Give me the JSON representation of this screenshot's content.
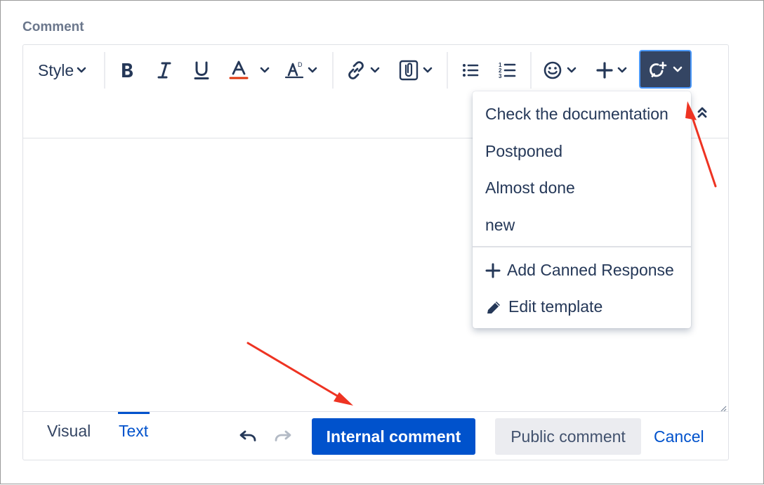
{
  "section_label": "Comment",
  "toolbar": {
    "style_label": "Style",
    "icons": [
      "bold-icon",
      "italic-icon",
      "underline-icon",
      "text-color-icon",
      "text-formatting-icon",
      "link-icon",
      "attachment-icon",
      "bullet-list-icon",
      "numbered-list-icon",
      "emoji-icon",
      "insert-plus-icon",
      "canned-responses-icon"
    ]
  },
  "dropdown": {
    "responses": [
      "Check the documentation",
      "Postponed",
      "Almost done",
      "new"
    ],
    "add_label": "Add Canned Response",
    "edit_label": "Edit template"
  },
  "footer": {
    "tabs": {
      "visual": "Visual",
      "text": "Text",
      "active": "Text"
    },
    "internal_label": "Internal comment",
    "public_label": "Public comment",
    "cancel_label": "Cancel"
  },
  "colors": {
    "primary": "#0052cc",
    "active_toolbar_button": "#344563",
    "focus_ring": "#4c9aff",
    "text_color_underline": "#de350b",
    "annotation_arrow": "#ee3322"
  }
}
